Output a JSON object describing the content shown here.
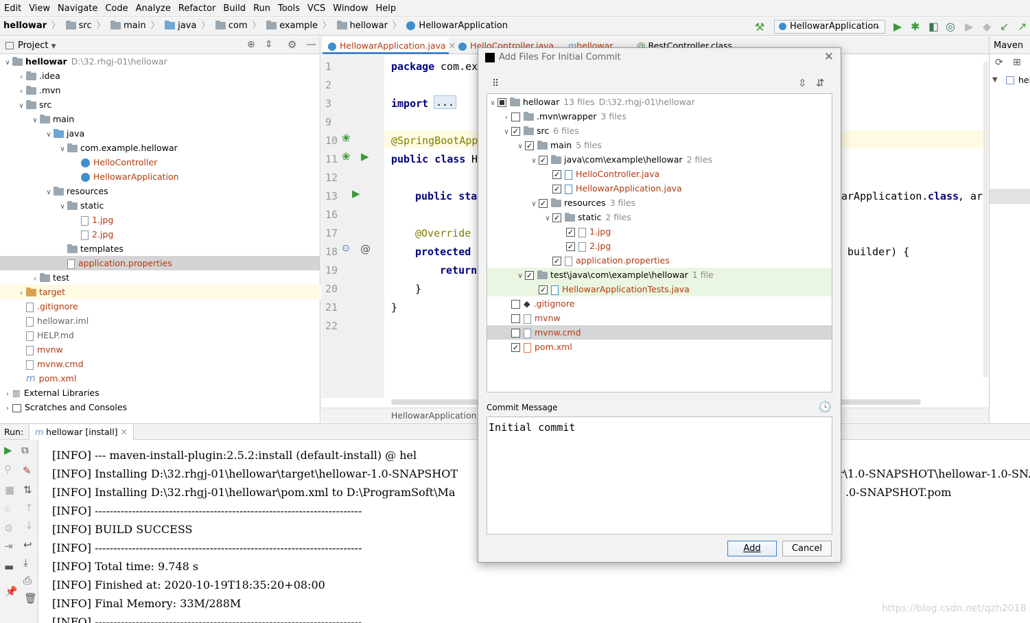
{
  "menu": [
    "Edit",
    "View",
    "Navigate",
    "Code",
    "Analyze",
    "Refactor",
    "Build",
    "Run",
    "Tools",
    "VCS",
    "Window",
    "Help"
  ],
  "breadcrumb": [
    "hellowar",
    "src",
    "main",
    "java",
    "com",
    "example",
    "hellowar",
    "HellowarApplication"
  ],
  "run_config": "HellowarApplication",
  "project_panel": {
    "title": "Project",
    "tree": [
      {
        "label": "hellowar",
        "extra": "D:\\32.rhgj-01\\hellowar",
        "level": 0,
        "icon": "folder",
        "bold": true
      },
      {
        "label": ".idea",
        "level": 1,
        "icon": "folder"
      },
      {
        "label": ".mvn",
        "level": 1,
        "icon": "folder"
      },
      {
        "label": "src",
        "level": 1,
        "icon": "folder"
      },
      {
        "label": "main",
        "level": 2,
        "icon": "folder"
      },
      {
        "label": "java",
        "level": 3,
        "icon": "folder-blue"
      },
      {
        "label": "com.example.hellowar",
        "level": 4,
        "icon": "folder"
      },
      {
        "label": "HelloController",
        "level": 5,
        "icon": "class",
        "red": true
      },
      {
        "label": "HellowarApplication",
        "level": 5,
        "icon": "class",
        "red": true
      },
      {
        "label": "resources",
        "level": 3,
        "icon": "folder"
      },
      {
        "label": "static",
        "level": 4,
        "icon": "folder"
      },
      {
        "label": "1.jpg",
        "level": 5,
        "icon": "file",
        "red": true
      },
      {
        "label": "2.jpg",
        "level": 5,
        "icon": "file",
        "red": true
      },
      {
        "label": "templates",
        "level": 4,
        "icon": "folder"
      },
      {
        "label": "application.properties",
        "level": 4,
        "icon": "file",
        "red": true
      },
      {
        "label": "test",
        "level": 2,
        "icon": "folder"
      },
      {
        "label": "target",
        "level": 1,
        "icon": "folder-orange",
        "red": true
      },
      {
        "label": ".gitignore",
        "level": 1,
        "icon": "file",
        "red": true
      },
      {
        "label": "hellowar.iml",
        "level": 1,
        "icon": "file",
        "gray": true
      },
      {
        "label": "HELP.md",
        "level": 1,
        "icon": "file",
        "gray": true
      },
      {
        "label": "mvnw",
        "level": 1,
        "icon": "file",
        "red": true
      },
      {
        "label": "mvnw.cmd",
        "level": 1,
        "icon": "file",
        "red": true
      },
      {
        "label": "pom.xml",
        "level": 1,
        "icon": "maven",
        "red": true
      },
      {
        "label": "External Libraries",
        "level": 0,
        "icon": "lib"
      },
      {
        "label": "Scratches and Consoles",
        "level": 0,
        "icon": "scratch"
      }
    ]
  },
  "editor": {
    "tabs": [
      "HellowarApplication.java",
      "HelloController.java",
      "hellowar",
      "RestController.class"
    ],
    "line_numbers": [
      "1",
      "2",
      "3",
      "9",
      "10",
      "11",
      "12",
      "13",
      "16",
      "17",
      "18",
      "19",
      "20",
      "21",
      "22"
    ],
    "code": {
      "l1a": "package",
      "l1b": " com.ex",
      "l3a": "import",
      "l3b": "...",
      "l10": "@SpringBootApp",
      "l11a": "public class",
      "l11b": " H",
      "l13a": "public sta",
      "l13b": "arApplication.",
      "l13c": "class",
      "l13d": ", arg",
      "l17": "@Override",
      "l18a": "protected",
      "l18b": " builder) {",
      "l19": "return",
      "l20": "}",
      "l21": "}"
    },
    "footer": "HellowarApplication"
  },
  "maven_panel": {
    "title": "Maven",
    "item": "hell"
  },
  "run_panel": {
    "label": "Run:",
    "tab": "hellowar [install]",
    "lines": [
      "[INFO] --- maven-install-plugin:2.5.2:install (default-install) @ hel",
      "[INFO] Installing D:\\32.rhgj-01\\hellowar\\target\\hellowar-1.0-SNAPSHOT",
      "[INFO] Installing D:\\32.rhgj-01\\hellowar\\pom.xml to D:\\ProgramSoft\\Ma",
      "[INFO] ------------------------------------------------------------------------",
      "[INFO] BUILD SUCCESS",
      "[INFO] ------------------------------------------------------------------------",
      "[INFO] Total time: 9.748 s",
      "[INFO] Finished at: 2020-10-19T18:35:20+08:00",
      "[INFO] Final Memory: 33M/288M",
      "[INFO] ------------------------------------------------------------------------"
    ],
    "right_fragments": [
      "r\\1.0-SNAPSHOT\\hellowar-1.0-SNA",
      ".0-SNAPSHOT.pom"
    ],
    "watermark": "https://blog.csdn.net/qzh2018"
  },
  "dialog": {
    "title": "Add Files For Initial Commit",
    "tree": [
      {
        "label": "hellowar",
        "count": "13 files",
        "path": "D:\\32.rhgj-01\\hellowar",
        "level": 0,
        "state": "partial",
        "arrow": "down",
        "icon": "folder"
      },
      {
        "label": ".mvn\\wrapper",
        "count": "3 files",
        "level": 1,
        "state": "off",
        "arrow": "right",
        "icon": "folder"
      },
      {
        "label": "src",
        "count": "6 files",
        "level": 1,
        "state": "on",
        "arrow": "down",
        "icon": "folder"
      },
      {
        "label": "main",
        "count": "5 files",
        "level": 2,
        "state": "on",
        "arrow": "down",
        "icon": "folder"
      },
      {
        "label": "java\\com\\example\\hellowar",
        "count": "2 files",
        "level": 3,
        "state": "on",
        "arrow": "down",
        "icon": "folder"
      },
      {
        "label": "HelloController.java",
        "level": 4,
        "state": "on",
        "icon": "java",
        "red": true
      },
      {
        "label": "HellowarApplication.java",
        "level": 4,
        "state": "on",
        "icon": "java",
        "red": true
      },
      {
        "label": "resources",
        "count": "3 files",
        "level": 3,
        "state": "on",
        "arrow": "down",
        "icon": "folder"
      },
      {
        "label": "static",
        "count": "2 files",
        "level": 4,
        "state": "on",
        "arrow": "down",
        "icon": "folder"
      },
      {
        "label": "1.jpg",
        "level": 5,
        "state": "on",
        "icon": "file",
        "red": true
      },
      {
        "label": "2.jpg",
        "level": 5,
        "state": "on",
        "icon": "file",
        "red": true
      },
      {
        "label": "application.properties",
        "level": 4,
        "state": "on",
        "icon": "file",
        "red": true
      },
      {
        "label": "test\\java\\com\\example\\hellowar",
        "count": "1 file",
        "level": 2,
        "state": "on",
        "arrow": "down",
        "icon": "folder",
        "green": true
      },
      {
        "label": "HellowarApplicationTests.java",
        "level": 3,
        "state": "on",
        "icon": "java",
        "red": true,
        "green": true
      },
      {
        "label": ".gitignore",
        "level": 1,
        "state": "off",
        "icon": "git",
        "red": true
      },
      {
        "label": "mvnw",
        "level": 1,
        "state": "off",
        "icon": "file",
        "red": true
      },
      {
        "label": "mvnw.cmd",
        "level": 1,
        "state": "off",
        "icon": "file",
        "red": true,
        "selected": true
      },
      {
        "label": "pom.xml",
        "level": 1,
        "state": "on",
        "icon": "xml",
        "red": true
      }
    ],
    "commit_label": "Commit Message",
    "commit_message": "Initial commit",
    "add_button": "Add",
    "cancel_button": "Cancel"
  },
  "colors": {
    "accent": "#4083c9",
    "untracked": "#b5390f",
    "selection": "#d4d4d4"
  }
}
